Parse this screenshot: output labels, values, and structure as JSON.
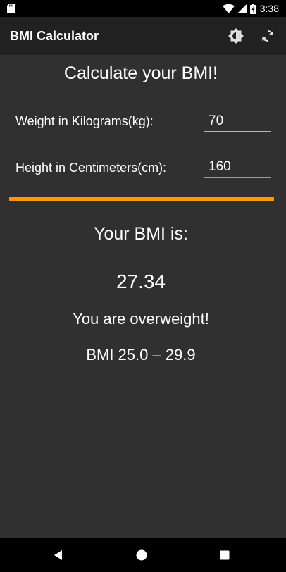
{
  "status_bar": {
    "time": "3:38",
    "icons": [
      "sd-card-icon",
      "wifi-icon",
      "cell-signal-icon",
      "battery-icon"
    ]
  },
  "app_bar": {
    "title": "BMI Calculator",
    "actions": [
      "brightness-icon",
      "refresh-icon"
    ]
  },
  "form": {
    "heading": "Calculate your BMI!",
    "weight_label": "Weight in Kilograms(kg):",
    "weight_value": "70",
    "height_label": "Height in Centimeters(cm):",
    "height_value": "160"
  },
  "result": {
    "title": "Your BMI is:",
    "value": "27.34",
    "status": "You are overweight!",
    "range": "BMI 25.0 – 29.9",
    "accent_color": "#ff9800"
  },
  "nav_bar": {
    "buttons": [
      "back-icon",
      "home-icon",
      "recents-icon"
    ]
  }
}
